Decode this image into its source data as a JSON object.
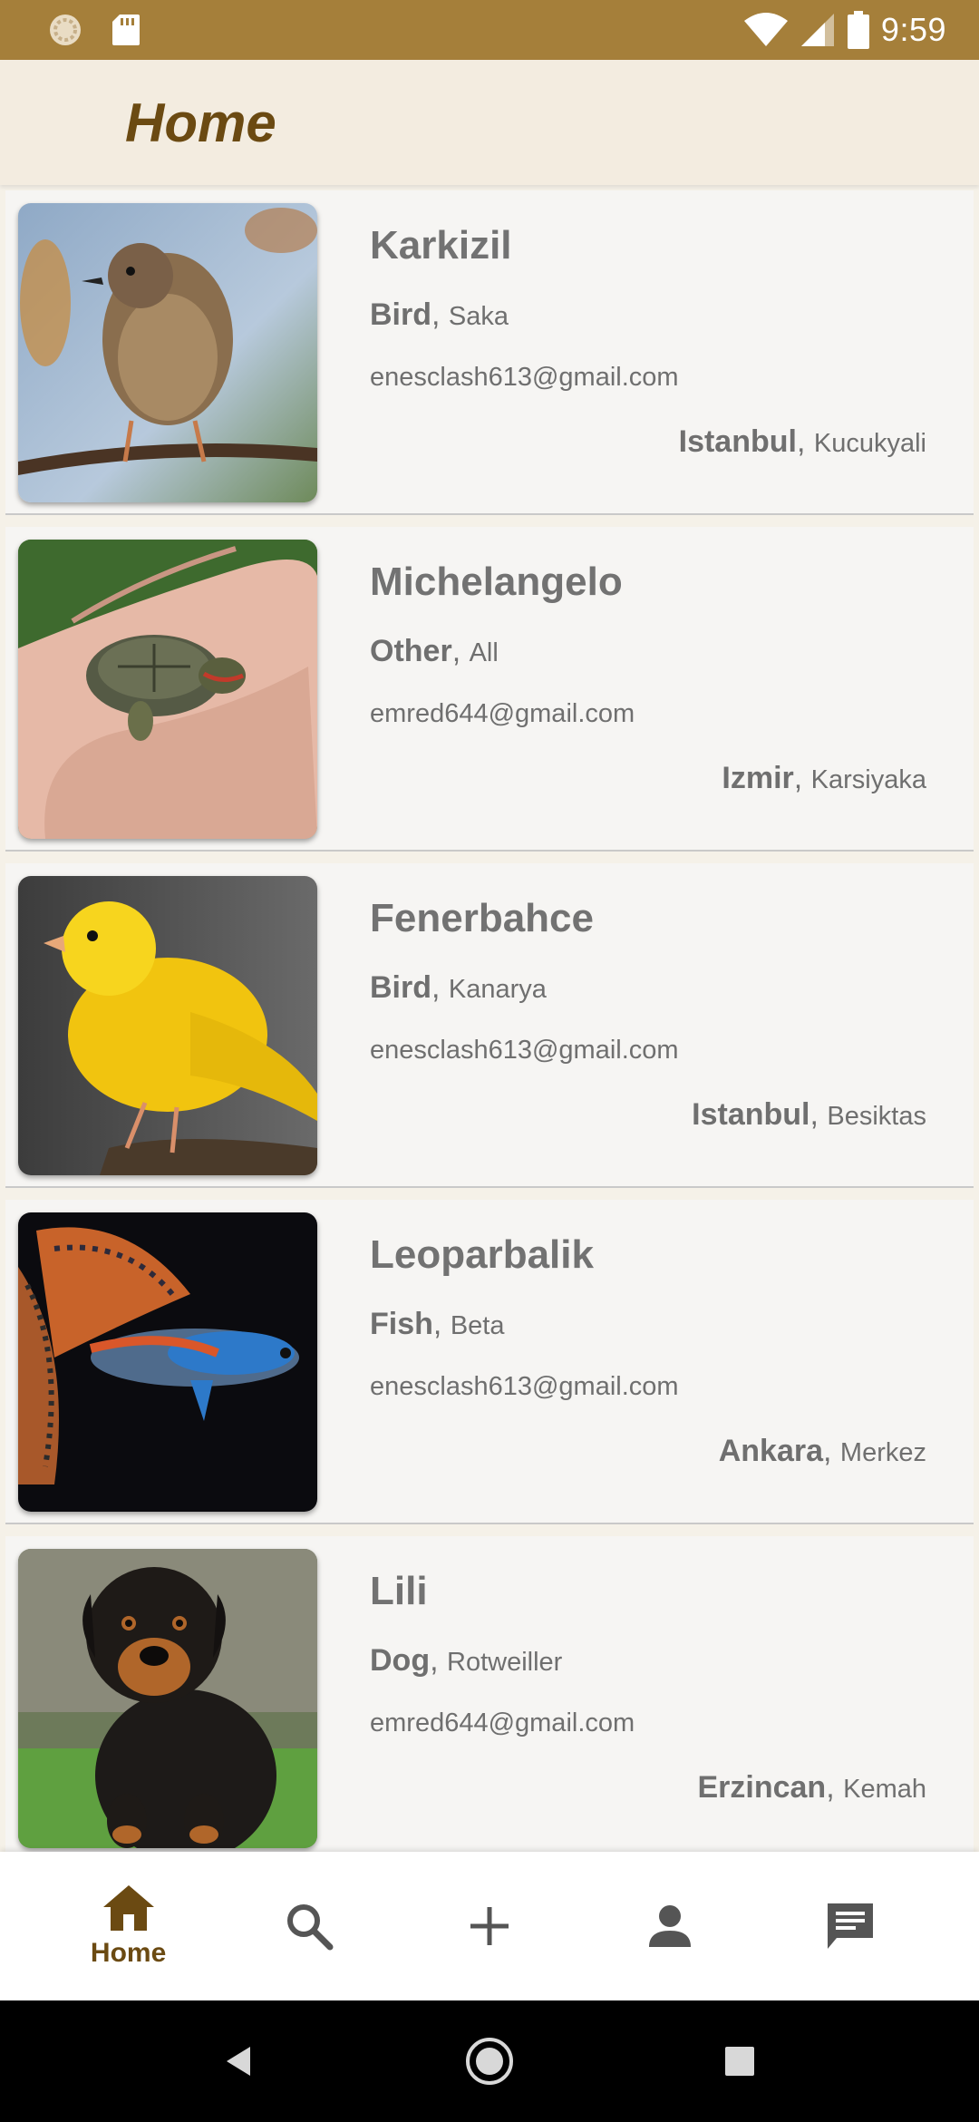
{
  "status_bar": {
    "time": "9:59",
    "icons": [
      "loader-icon",
      "sd-card-icon",
      "wifi-icon",
      "signal-icon",
      "battery-icon"
    ],
    "background": "#a57f3a"
  },
  "app_bar": {
    "title": "Home",
    "title_color": "#6b4a12"
  },
  "pets": [
    {
      "name": "Karkizil",
      "type": "Bird",
      "breed": "Saka",
      "email": "enesclash613@gmail.com",
      "city": "Istanbul",
      "district": "Kucukyali",
      "image": "sparrow-bird-photo"
    },
    {
      "name": "Michelangelo",
      "type": "Other",
      "breed": "All",
      "email": "emred644@gmail.com",
      "city": "Izmir",
      "district": "Karsiyaka",
      "image": "turtle-in-hand-photo"
    },
    {
      "name": "Fenerbahce",
      "type": "Bird",
      "breed": "Kanarya",
      "email": "enesclash613@gmail.com",
      "city": "Istanbul",
      "district": "Besiktas",
      "image": "yellow-canary-photo"
    },
    {
      "name": "Leoparbalik",
      "type": "Fish",
      "breed": "Beta",
      "email": "enesclash613@gmail.com",
      "city": "Ankara",
      "district": "Merkez",
      "image": "guppy-fish-photo"
    },
    {
      "name": "Lili",
      "type": "Dog",
      "breed": "Rotweiller",
      "email": "emred644@gmail.com",
      "city": "Erzincan",
      "district": "Kemah",
      "image": "rottweiler-puppy-photo"
    }
  ],
  "bottom_nav": {
    "items": [
      {
        "icon": "home-icon",
        "label": "Home",
        "active": true
      },
      {
        "icon": "search-icon",
        "label": "",
        "active": false
      },
      {
        "icon": "plus-icon",
        "label": "",
        "active": false
      },
      {
        "icon": "person-icon",
        "label": "",
        "active": false
      },
      {
        "icon": "chat-icon",
        "label": "",
        "active": false
      }
    ],
    "active_color": "#6b4a12",
    "inactive_color": "#555555"
  },
  "system_nav": {
    "icons": [
      "back-icon",
      "home-circle-icon",
      "recents-icon"
    ]
  }
}
